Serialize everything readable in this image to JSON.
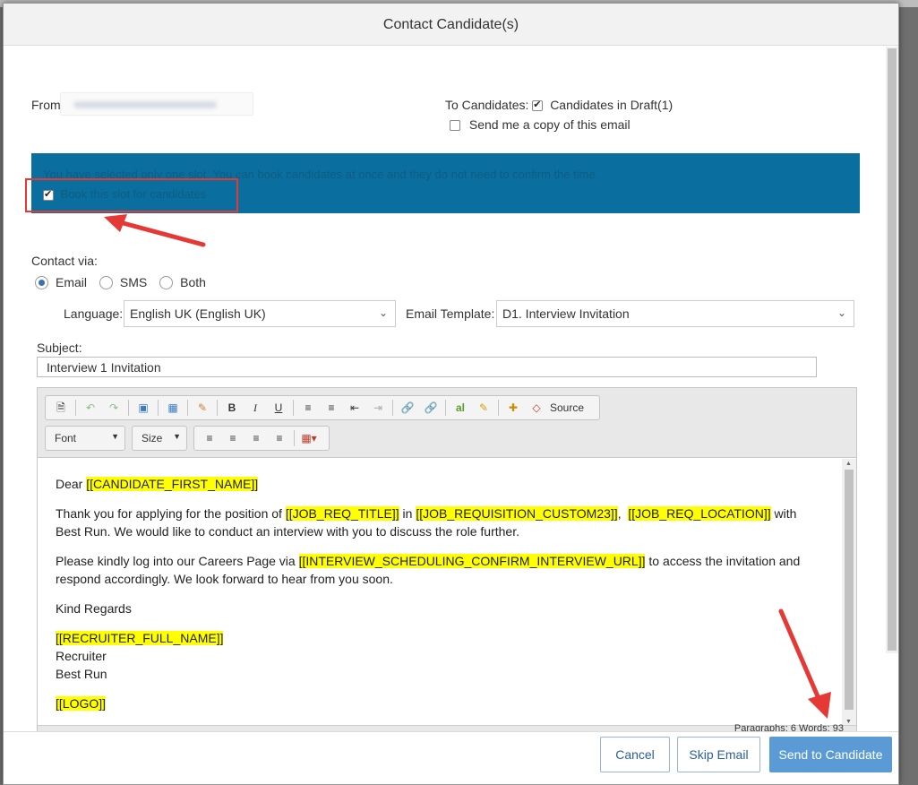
{
  "dialog": {
    "title": "Contact Candidate(s)"
  },
  "from": {
    "label": "From"
  },
  "to": {
    "label": "To Candidates:",
    "option": "Candidates in Draft(1)",
    "copy_label": "Send me a copy of this email"
  },
  "banner": {
    "message": "You have selected only one slot. You can book candidates at once and they do not need to confirm the time.",
    "book_label": "Book this slot for candidates"
  },
  "contact": {
    "label": "Contact via:",
    "options": [
      "Email",
      "SMS",
      "Both"
    ],
    "selected": "Email"
  },
  "language": {
    "label": "Language:",
    "value": "English UK (English UK)"
  },
  "template": {
    "label": "Email Template:",
    "value": "D1. Interview Invitation"
  },
  "subject": {
    "label": "Subject:",
    "value": "Interview 1 Invitation"
  },
  "toolbar": {
    "source_label": "Source",
    "font_label": "Font",
    "size_label": "Size"
  },
  "body": {
    "greeting": "Dear ",
    "ph_first_name": "[[CANDIDATE_FIRST_NAME]]",
    "p1_a": "Thank you for applying for the position of ",
    "ph_job_title": "[[JOB_REQ_TITLE]]",
    "p1_b": " in ",
    "ph_custom23": "[[JOB_REQUISITION_CUSTOM23]]",
    "p1_c": ",  ",
    "ph_location": "[[JOB_REQ_LOCATION]]",
    "p1_d": " with Best Run. We would like to conduct an interview with you to discuss the role further.",
    "p2_a": "Please kindly log into our Careers Page via ",
    "ph_url": "[[INTERVIEW_SCHEDULING_CONFIRM_INTERVIEW_URL]]",
    "p2_b": " to access the invitation and respond accordingly. We look forward to hear from you soon.",
    "regards": "Kind Regards",
    "ph_recruiter": "[[RECRUITER_FULL_NAME]]",
    "role": "Recruiter",
    "company": "Best Run",
    "ph_logo": "[[LOGO]]"
  },
  "status": {
    "text": "Paragraphs: 6  Words: 93"
  },
  "buttons": {
    "cancel": "Cancel",
    "skip": "Skip Email",
    "send": "Send to Candidate"
  },
  "colors": {
    "banner": "#0a6f9e",
    "primary": "#5b9bd5",
    "highlight": "#ffff00",
    "annotation": "#e53935"
  }
}
